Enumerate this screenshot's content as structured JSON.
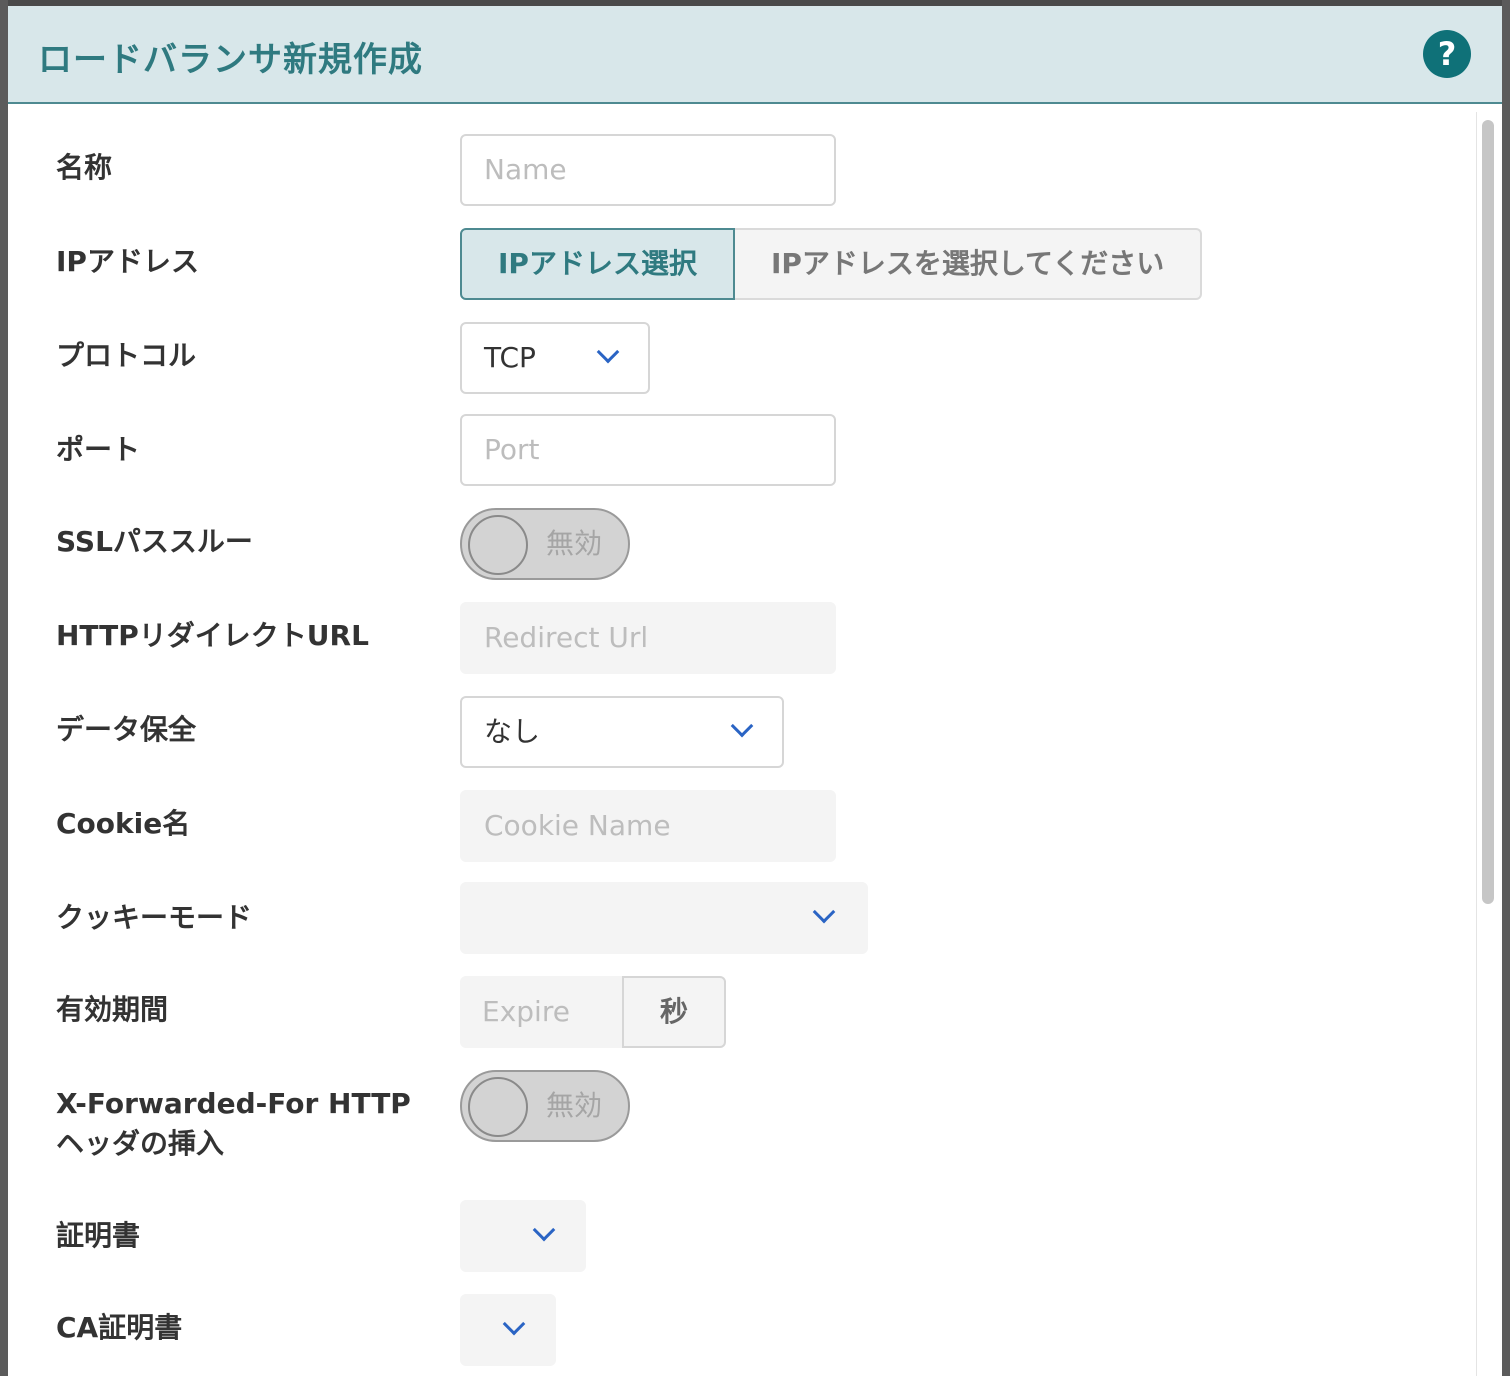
{
  "dialog": {
    "title": "ロードバランサ新規作成",
    "help_icon": "question-circle-icon",
    "help_label": "?"
  },
  "form": {
    "name": {
      "label": "名称",
      "placeholder": "Name",
      "value": ""
    },
    "ip_address": {
      "label": "IPアドレス",
      "button_label": "IPアドレス選択",
      "display_text": "IPアドレスを選択してください"
    },
    "protocol": {
      "label": "プロトコル",
      "value": "TCP"
    },
    "port": {
      "label": "ポート",
      "placeholder": "Port",
      "value": ""
    },
    "ssl_passthrough": {
      "label": "SSLパススルー",
      "state": "無効"
    },
    "http_redirect_url": {
      "label": "HTTPリダイレクトURL",
      "placeholder": "Redirect Url",
      "value": ""
    },
    "data_persistence": {
      "label": "データ保全",
      "value": "なし"
    },
    "cookie_name": {
      "label": "Cookie名",
      "placeholder": "Cookie Name",
      "value": ""
    },
    "cookie_mode": {
      "label": "クッキーモード",
      "value": ""
    },
    "expire": {
      "label": "有効期間",
      "placeholder": "Expire",
      "unit": "秒"
    },
    "x_forwarded_for": {
      "label_line1": "X-Forwarded-For HTTP",
      "label_line2": "ヘッダの挿入",
      "state": "無効"
    },
    "certificate": {
      "label": "証明書",
      "value": ""
    },
    "ca_certificate": {
      "label": "CA証明書",
      "value": ""
    }
  },
  "colors": {
    "accent": "#2f7a80",
    "header_bg": "#d8e7ea",
    "chevron": "#2a64c4"
  }
}
